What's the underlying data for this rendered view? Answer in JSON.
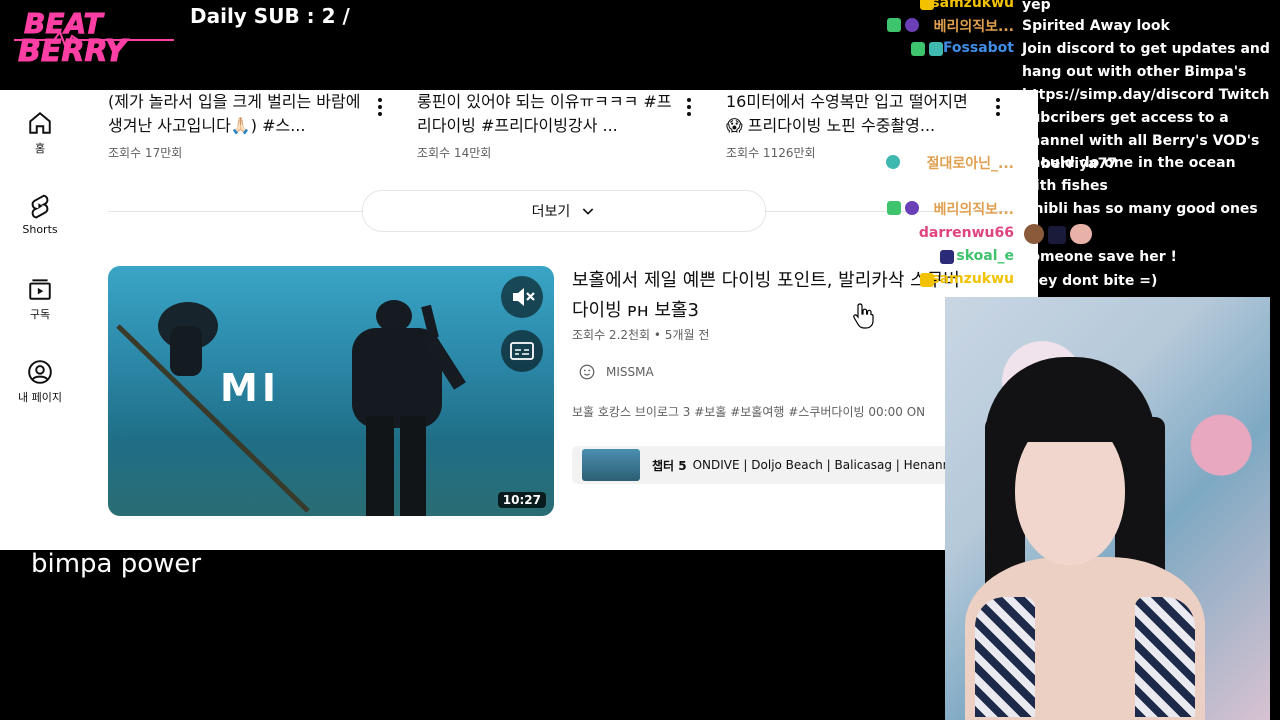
{
  "overlay": {
    "logo_line1": "BEAT",
    "logo_line2": "BERRY",
    "daily_sub": "Daily SUB : 2 /"
  },
  "sidebar": {
    "items": [
      {
        "label": "홈",
        "icon": "home-icon"
      },
      {
        "label": "Shorts",
        "icon": "shorts-icon"
      },
      {
        "label": "구독",
        "icon": "subscriptions-icon"
      },
      {
        "label": "내 페이지",
        "icon": "account-icon"
      }
    ]
  },
  "top_videos": [
    {
      "title": "(제가 놀라서 입을 크게 벌리는 바람에 생겨난 사고입니다🙏🏻) #스...",
      "views": "조회수 17만회"
    },
    {
      "title": "롱핀이 있어야 되는 이유ㅠㅋㅋㅋ #프리다이빙 #프리다이빙강사 ...",
      "views": "조회수 14만회"
    },
    {
      "title": "16미터에서 수영복만 입고 떨어지면😱 프리다이빙 노핀 수중촬영...",
      "views": "조회수 1126만회"
    }
  ],
  "more_button": "더보기",
  "featured": {
    "title": "보홀에서 제일 예쁜 다이빙 포인트, 발리카삭 스쿠버다이빙 ᴘʜ 보홀3",
    "meta": "조회수 2.2천회 • 5개월 전",
    "channel": "MISSMA",
    "description": "보홀 호캉스 브이로그 3 #보홀 #보홀여행 #스쿠버다이빙 00:00 ON",
    "chapter_label": "챕터 5",
    "chapter_title": "ONDIVE | Doljo Beach | Balicasag | Henann",
    "duration": "10:27",
    "thumb_text": "MI"
  },
  "caption": "bimpa power",
  "chat": [
    {
      "name": "samzukwu",
      "name_color": "#f2c200",
      "message": "yep"
    },
    {
      "name": "베리의직보...",
      "name_color": "#e0a050",
      "message": "Spirited Away look"
    },
    {
      "name": "Fossabot",
      "name_color": "#3f8ee8",
      "message": "Join discord to get updates and hang out with other Bimpa's https://simp.day/discord Twitch subcribers get access to a channel with all Berry's VOD's 🅰 berriya77"
    },
    {
      "name": "절대로아닌_...",
      "name_color": "#e0a050",
      "message": "should do one in the ocean with fishes"
    },
    {
      "name": "베리의직보...",
      "name_color": "#e0a050",
      "message": "Ghibli has so many good ones"
    },
    {
      "name": "darrenwu66",
      "name_color": "#e0447f",
      "message": ""
    },
    {
      "name": "skoal_e",
      "name_color": "#3ec46d",
      "message": "someone save her !"
    },
    {
      "name": "samzukwu",
      "name_color": "#f2c200",
      "message": "they dont bite =)"
    }
  ],
  "colors": {
    "logo_pink": "#ff3fa4",
    "yt_bg": "#ffffff",
    "yt_text": "#0f0f0f",
    "yt_meta": "#606060"
  }
}
